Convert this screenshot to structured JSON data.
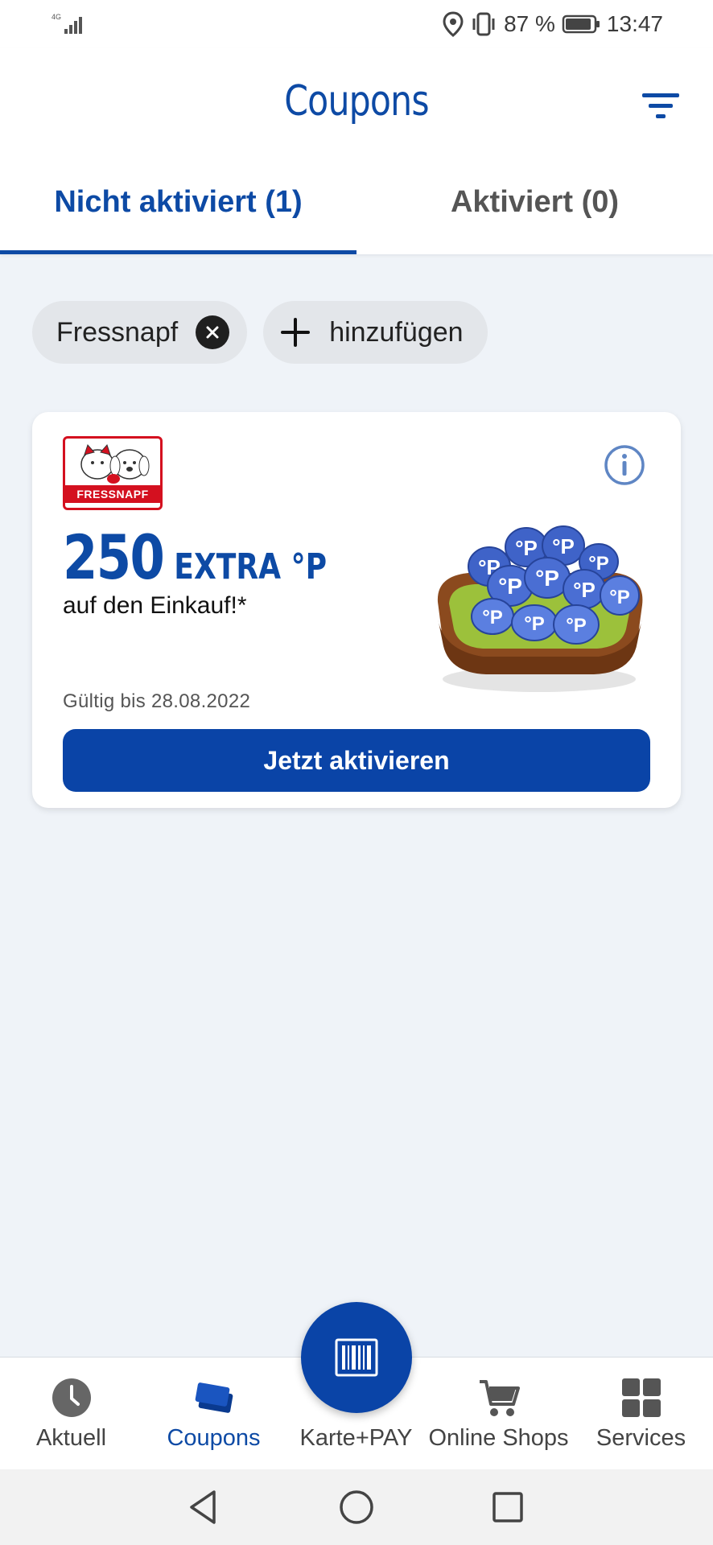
{
  "status_bar": {
    "network": "4G",
    "battery": "87 %",
    "time": "13:47"
  },
  "header": {
    "title": "Coupons",
    "filter_icon": "filter-icon"
  },
  "tabs": [
    {
      "label": "Nicht aktiviert (1)",
      "active": true
    },
    {
      "label": "Aktiviert (0)",
      "active": false
    }
  ],
  "chips": {
    "partner_label": "Fressnapf",
    "add_label": "hinzufügen"
  },
  "coupon": {
    "logo_text": "FRESSNAPF",
    "amount": "250",
    "extra": "EXTRA °P",
    "subtitle": "auf den Einkauf!*",
    "valid_until": "Gültig bis 28.08.2022",
    "button_label": "Jetzt aktivieren",
    "coin_text": "°P",
    "accent_color": "#0a44a7"
  },
  "bottom_nav": {
    "items": [
      {
        "label": "Aktuell",
        "icon": "clock-icon",
        "active": false
      },
      {
        "label": "Coupons",
        "icon": "coupons-icon",
        "active": true
      },
      {
        "label": "Karte+PAY",
        "icon": "barcode-icon",
        "active": false
      },
      {
        "label": "Online Shops",
        "icon": "cart-icon",
        "active": false
      },
      {
        "label": "Services",
        "icon": "grid-icon",
        "active": false
      }
    ]
  }
}
